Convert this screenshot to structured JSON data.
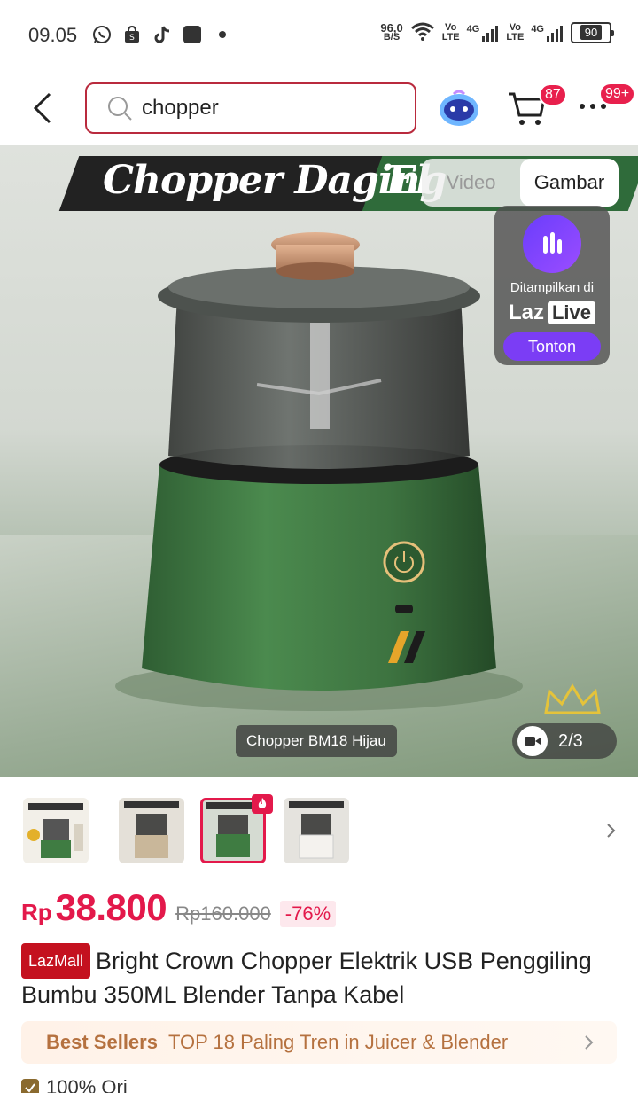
{
  "status_bar": {
    "time": "09.05",
    "net_speed_value": "96,0",
    "net_speed_unit": "B/S",
    "sim1_label_top": "Vo",
    "sim1_label_bottom": "LTE",
    "sim1_net": "4G",
    "sim2_label_top": "Vo",
    "sim2_label_bottom": "LTE",
    "sim2_net": "4G",
    "battery": "90"
  },
  "header": {
    "search_value": "chopper",
    "cart_badge": "87",
    "more_badge": "99+"
  },
  "hero": {
    "banner_text": "Chopper Daging",
    "banner_text_2": "El",
    "toggle_video": "Video",
    "toggle_image": "Gambar",
    "live_caption": "Ditampilkan di",
    "live_brand": "Laz",
    "live_brand_pill": "Live",
    "live_button": "Tonton",
    "image_caption": "Chopper BM18 Hijau",
    "image_counter": "2/3"
  },
  "price": {
    "currency": "Rp",
    "value": "38.800",
    "original": "Rp160.000",
    "discount": "-76%"
  },
  "product": {
    "badge": "LazMall",
    "title": "Bright Crown Chopper Elektrik USB Penggiling Bumbu 350ML Blender Tanpa Kabel"
  },
  "best_seller": {
    "label": "Best Sellers",
    "text": "TOP 18 Paling Tren in Juicer & Blender"
  },
  "assurance": {
    "text": "100% Ori"
  },
  "colors": {
    "accent": "#e3194b",
    "search_border": "#b92a3d",
    "live_purple": "#7b3df5",
    "product_green": "#2f6b3a"
  }
}
